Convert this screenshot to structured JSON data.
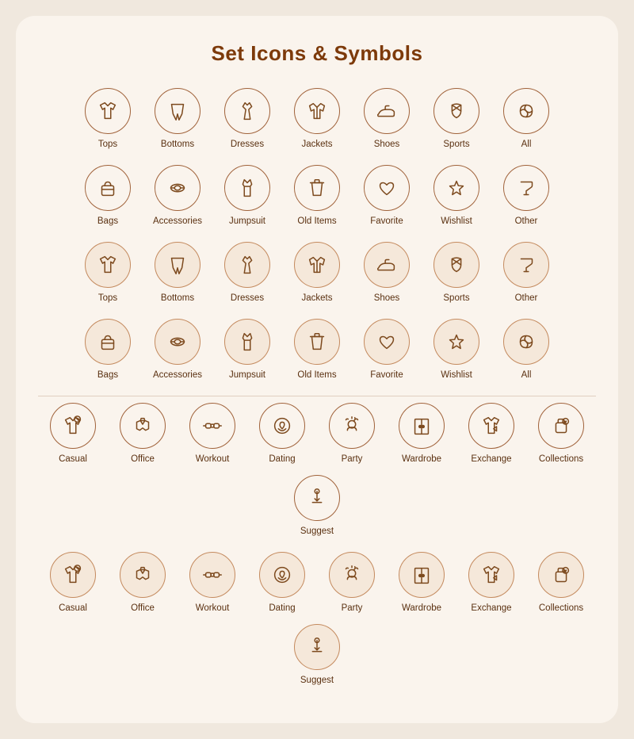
{
  "title": "Set Icons & Symbols",
  "rows": [
    {
      "type": "outlined",
      "items": [
        {
          "label": "Tops",
          "icon": "tops"
        },
        {
          "label": "Bottoms",
          "icon": "bottoms"
        },
        {
          "label": "Dresses",
          "icon": "dresses"
        },
        {
          "label": "Jackets",
          "icon": "jackets"
        },
        {
          "label": "Shoes",
          "icon": "shoes"
        },
        {
          "label": "Sports",
          "icon": "sports"
        },
        {
          "label": "All",
          "icon": "all"
        }
      ]
    },
    {
      "type": "outlined",
      "items": [
        {
          "label": "Bags",
          "icon": "bags"
        },
        {
          "label": "Accessories",
          "icon": "accessories"
        },
        {
          "label": "Jumpsuit",
          "icon": "jumpsuit"
        },
        {
          "label": "Old Items",
          "icon": "olditems"
        },
        {
          "label": "Favorite",
          "icon": "favorite"
        },
        {
          "label": "Wishlist",
          "icon": "wishlist"
        },
        {
          "label": "Other",
          "icon": "other"
        }
      ]
    },
    {
      "type": "filled",
      "items": [
        {
          "label": "Tops",
          "icon": "tops"
        },
        {
          "label": "Bottoms",
          "icon": "bottoms"
        },
        {
          "label": "Dresses",
          "icon": "dresses"
        },
        {
          "label": "Jackets",
          "icon": "jackets"
        },
        {
          "label": "Shoes",
          "icon": "shoes"
        },
        {
          "label": "Sports",
          "icon": "sports"
        },
        {
          "label": "Other",
          "icon": "other"
        }
      ]
    },
    {
      "type": "filled",
      "items": [
        {
          "label": "Bags",
          "icon": "bags"
        },
        {
          "label": "Accessories",
          "icon": "accessories"
        },
        {
          "label": "Jumpsuit",
          "icon": "jumpsuit"
        },
        {
          "label": "Old Items",
          "icon": "olditems"
        },
        {
          "label": "Favorite",
          "icon": "favorite"
        },
        {
          "label": "Wishlist",
          "icon": "wishlist"
        },
        {
          "label": "All",
          "icon": "all"
        }
      ]
    },
    {
      "type": "outlined",
      "items": [
        {
          "label": "Casual",
          "icon": "casual"
        },
        {
          "label": "Office",
          "icon": "office"
        },
        {
          "label": "Workout",
          "icon": "workout"
        },
        {
          "label": "Dating",
          "icon": "dating"
        },
        {
          "label": "Party",
          "icon": "party"
        },
        {
          "label": "Wardrobe",
          "icon": "wardrobe"
        },
        {
          "label": "Exchange",
          "icon": "exchange"
        },
        {
          "label": "Collections",
          "icon": "collections"
        },
        {
          "label": "Suggest",
          "icon": "suggest"
        }
      ]
    },
    {
      "type": "filled",
      "items": [
        {
          "label": "Casual",
          "icon": "casual"
        },
        {
          "label": "Office",
          "icon": "office"
        },
        {
          "label": "Workout",
          "icon": "workout"
        },
        {
          "label": "Dating",
          "icon": "dating"
        },
        {
          "label": "Party",
          "icon": "party"
        },
        {
          "label": "Wardrobe",
          "icon": "wardrobe"
        },
        {
          "label": "Exchange",
          "icon": "exchange"
        },
        {
          "label": "Collections",
          "icon": "collections"
        },
        {
          "label": "Suggest",
          "icon": "suggest"
        }
      ]
    }
  ]
}
